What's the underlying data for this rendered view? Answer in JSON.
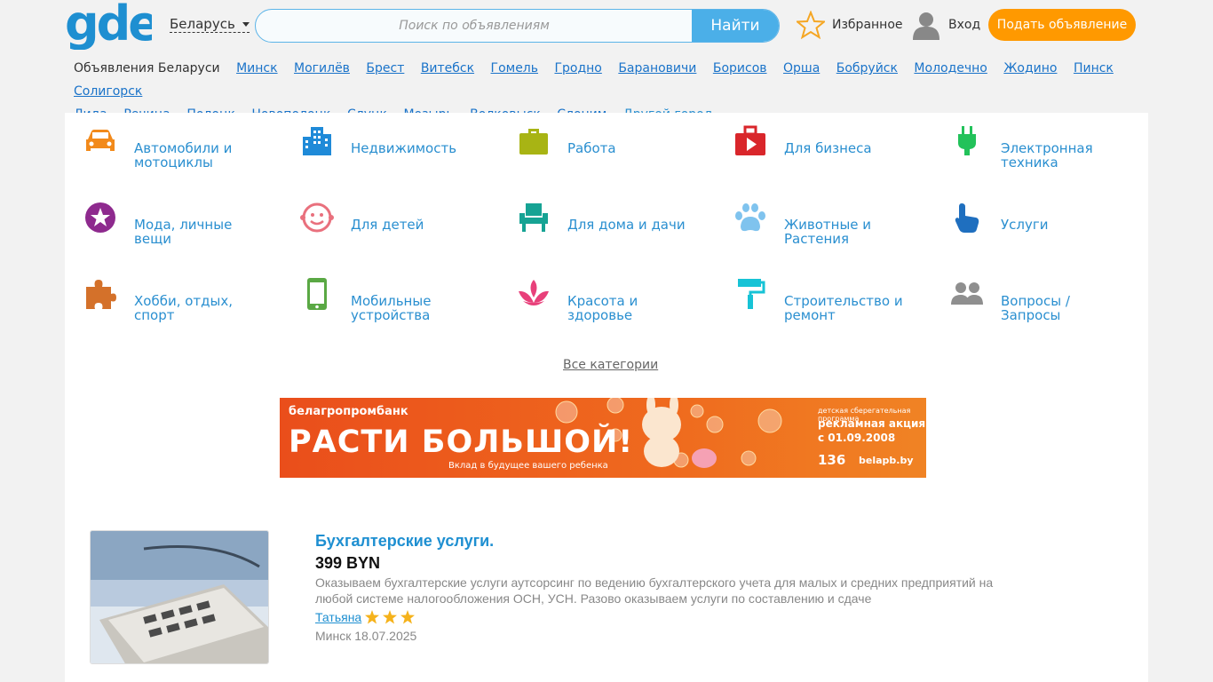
{
  "header": {
    "logo_text": "gde",
    "country": "Беларусь",
    "search_placeholder": "Поиск по объявлениям",
    "search_button": "Найти",
    "favorites": "Избранное",
    "login": "Вход",
    "post_ad": "Подать объявление",
    "colors": {
      "brand": "#1e8fd1",
      "accent": "#ff9900"
    }
  },
  "cities": {
    "home": "Объявления Беларуси",
    "links": [
      "Минск",
      "Могилёв",
      "Брест",
      "Витебск",
      "Гомель",
      "Гродно",
      "Барановичи",
      "Борисов",
      "Орша",
      "Бобруйск",
      "Молодечно",
      "Жодино",
      "Пинск",
      "Солигорск",
      "Лида",
      "Речица",
      "Полоцк",
      "Новополоцк",
      "Слуцк",
      "Мозырь",
      "Волковыск",
      "Слоним"
    ],
    "other": "Другой город"
  },
  "categories": [
    {
      "label": "Автомобили и мотоциклы",
      "icon": "car-icon",
      "color": "#f28a1b"
    },
    {
      "label": "Недвижимость",
      "icon": "buildings-icon",
      "color": "#1f8ad8"
    },
    {
      "label": "Работа",
      "icon": "briefcase-icon",
      "color": "#a8b414"
    },
    {
      "label": "Для бизнеса",
      "icon": "video-play-icon",
      "color": "#d9262b"
    },
    {
      "label": "Электронная техника",
      "icon": "plug-icon",
      "color": "#22c25a"
    },
    {
      "label": "Мода, личные вещи",
      "icon": "star-badge-icon",
      "color": "#8e2a8e"
    },
    {
      "label": "Для детей",
      "icon": "baby-face-icon",
      "color": "#e9707d"
    },
    {
      "label": "Для дома и дачи",
      "icon": "armchair-icon",
      "color": "#16a394"
    },
    {
      "label": "Животные и Растения",
      "icon": "paw-icon",
      "color": "#7fc3ee"
    },
    {
      "label": "Услуги",
      "icon": "hand-pointer-icon",
      "color": "#1f6fbf"
    },
    {
      "label": "Хобби, отдых, спорт",
      "icon": "puzzle-icon",
      "color": "#d4712a"
    },
    {
      "label": "Мобильные устройства",
      "icon": "smartphone-icon",
      "color": "#5aa844"
    },
    {
      "label": "Красота и здоровье",
      "icon": "lotus-icon",
      "color": "#e8407a"
    },
    {
      "label": "Строительство и ремонт",
      "icon": "paint-roller-icon",
      "color": "#17c3d6"
    },
    {
      "label": "Вопросы / Запросы",
      "icon": "people-icon",
      "color": "#8f8f8f"
    }
  ],
  "all_categories": "Все категории",
  "banner": {
    "bank": "белагропромбанк",
    "headline": "РАСТИ БОЛЬШОЙ!",
    "subline": "Вклад в будущее вашего ребенка",
    "promo_line1": "детская сберегательная программа",
    "promo_line2": "рекламная акция",
    "promo_line3": "с 01.09.2008",
    "phone": "136",
    "site": "belapb.by"
  },
  "listing": {
    "title": "Бухгалтерские услуги.",
    "price": "399 BYN",
    "description": "Оказываем бухгалтерские услуги аутсорсинг по ведению бухгалтерского учета для малых и средних предприятий на любой системе налогообложения ОСН, УСН. Разово оказываем услуги по составлению и сдаче",
    "seller": "Татьяна",
    "rating": 3,
    "location_date": "Минск 18.07.2025"
  }
}
